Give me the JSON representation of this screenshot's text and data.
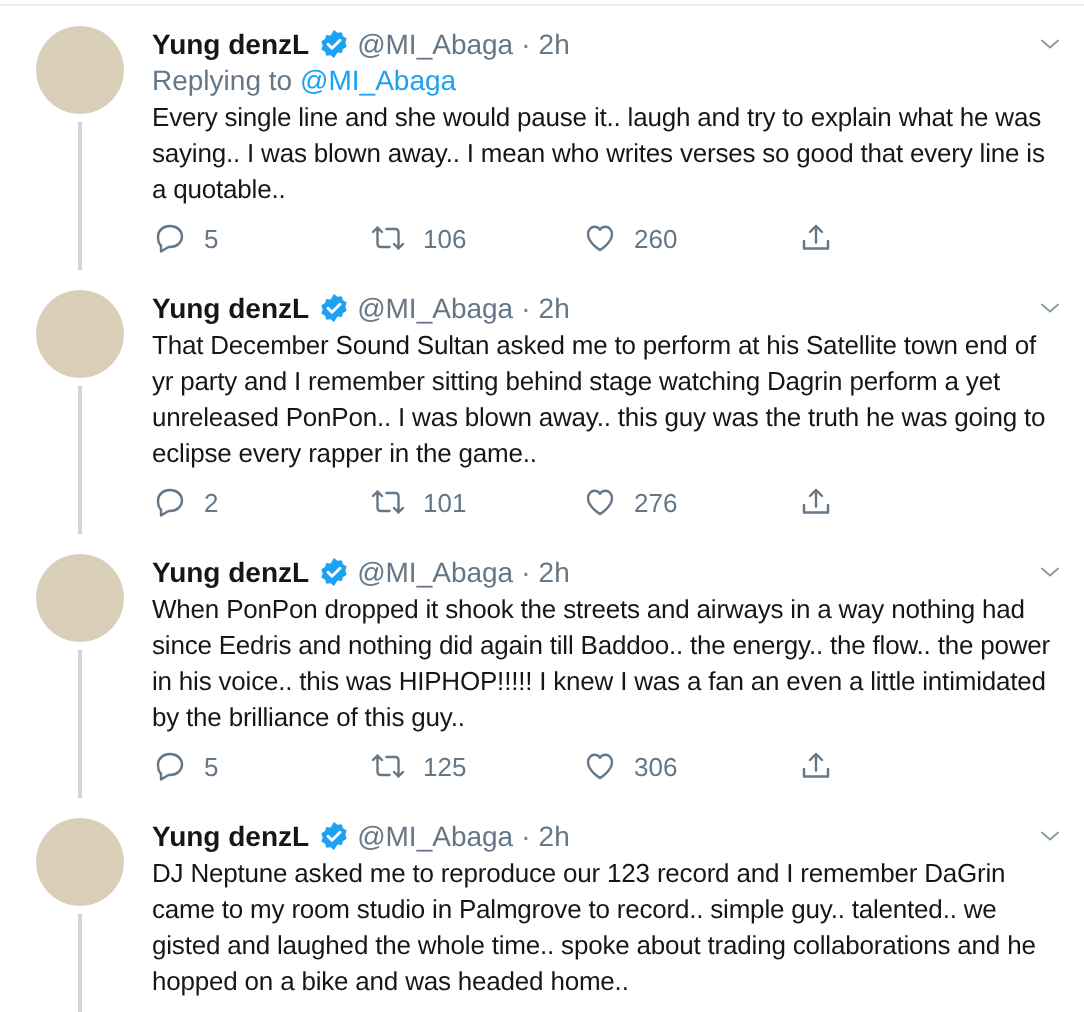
{
  "separator": "·",
  "tweets": [
    {
      "name": "Yung denzL",
      "verified": true,
      "handle": "@MI_Abaga",
      "time": "2h",
      "replying_to": {
        "prefix": "Replying to",
        "handle": "@MI_Abaga"
      },
      "text": "Every single line and she would pause it.. laugh and try to explain what he was saying.. I was blown away.. I mean who writes verses so good that every line is a quotable..",
      "actions": {
        "replies": "5",
        "retweets": "106",
        "likes": "260"
      }
    },
    {
      "name": "Yung denzL",
      "verified": true,
      "handle": "@MI_Abaga",
      "time": "2h",
      "text": "That December Sound Sultan asked me to perform at his Satellite town end of yr party and I remember sitting behind stage watching Dagrin perform a yet unreleased PonPon.. I was blown away.. this guy was the truth he was going to eclipse every rapper in the game..",
      "actions": {
        "replies": "2",
        "retweets": "101",
        "likes": "276"
      }
    },
    {
      "name": "Yung denzL",
      "verified": true,
      "handle": "@MI_Abaga",
      "time": "2h",
      "text": "When PonPon dropped it shook the streets and airways in a way nothing had since Eedris and nothing did again till Baddoo.. the energy.. the flow.. the power in his voice.. this was HIPHOP!!!!! I knew I was a fan an even a little intimidated by the brilliance of this guy..",
      "actions": {
        "replies": "5",
        "retweets": "125",
        "likes": "306"
      }
    },
    {
      "name": "Yung denzL",
      "verified": true,
      "handle": "@MI_Abaga",
      "time": "2h",
      "text": "DJ Neptune asked me to reproduce our 123 record and I remember DaGrin came to my room studio in Palmgrove to record.. simple guy.. talented.. we gisted and laughed the whole time.. spoke about trading collaborations and he hopped on a bike and was headed home.."
    }
  ]
}
